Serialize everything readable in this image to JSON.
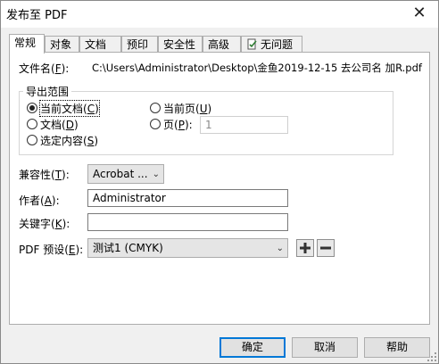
{
  "window": {
    "title": "发布至 PDF",
    "close_glyph": "✕"
  },
  "tabs": [
    {
      "label": "常规",
      "active": true
    },
    {
      "label": "对象"
    },
    {
      "label": "文档"
    },
    {
      "label": "预印"
    },
    {
      "label": "安全性"
    },
    {
      "label": "高级"
    },
    {
      "label": "无问题",
      "icon": "document-check-icon"
    }
  ],
  "filename": {
    "label": "文件名",
    "hotkey": "F",
    "value": "C:\\Users\\Administrator\\Desktop\\金鱼2019-12-15 去公司名 加R.pdf"
  },
  "export_range": {
    "title": "导出范围",
    "options": {
      "current_doc": {
        "label": "当前文档",
        "hotkey": "C",
        "selected": true
      },
      "doc": {
        "label": "文档",
        "hotkey": "D"
      },
      "selection": {
        "label": "选定内容",
        "hotkey": "S"
      },
      "current_page": {
        "label": "当前页",
        "hotkey": "U"
      },
      "pages": {
        "label": "页",
        "hotkey": "P"
      }
    },
    "pages_value": "1"
  },
  "compatibility": {
    "label": "兼容性",
    "hotkey": "T",
    "value": "Acrobat ..."
  },
  "author": {
    "label": "作者",
    "hotkey": "A",
    "value": "Administrator"
  },
  "keywords": {
    "label": "关键字",
    "hotkey": "K",
    "value": ""
  },
  "pdf_preset": {
    "label": "PDF 预设",
    "hotkey": "E",
    "value": "测试1 (CMYK)"
  },
  "buttons": {
    "ok": "确定",
    "cancel": "取消",
    "help": "帮助"
  }
}
